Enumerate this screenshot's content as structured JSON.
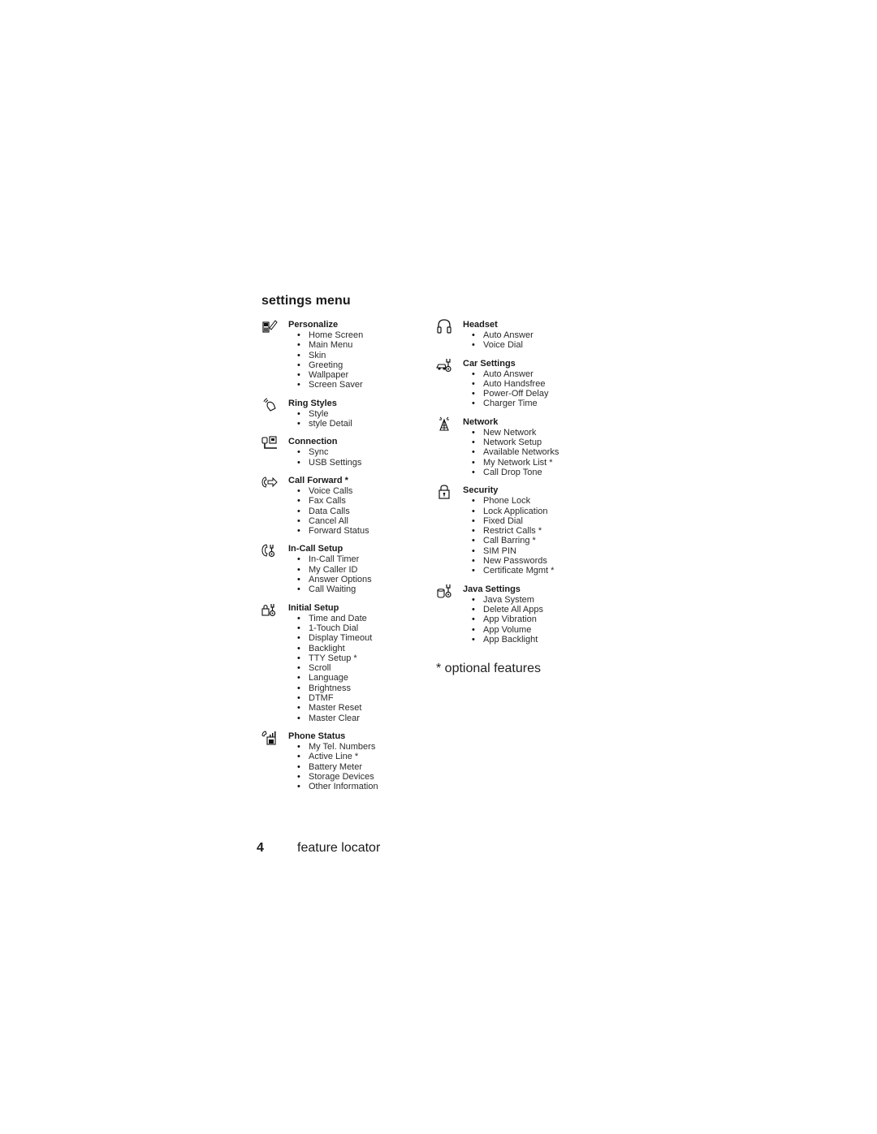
{
  "title": "settings menu",
  "left_column": [
    {
      "icon": "personalize-icon",
      "title": "Personalize",
      "items": [
        "Home Screen",
        "Main Menu",
        "Skin",
        "Greeting",
        "Wallpaper",
        "Screen Saver"
      ]
    },
    {
      "icon": "ring-styles-icon",
      "title": "Ring Styles",
      "items": [
        "Style",
        " style Detail"
      ]
    },
    {
      "icon": "connection-icon",
      "title": "Connection",
      "items": [
        "Sync",
        "USB Settings"
      ]
    },
    {
      "icon": "call-forward-icon",
      "title": "Call Forward *",
      "items": [
        "Voice Calls",
        "Fax Calls",
        "Data Calls",
        "Cancel All",
        "Forward Status"
      ]
    },
    {
      "icon": "in-call-setup-icon",
      "title": "In-Call Setup",
      "items": [
        "In-Call Timer",
        "My Caller ID",
        "Answer Options",
        "Call Waiting"
      ]
    },
    {
      "icon": "initial-setup-icon",
      "title": "Initial Setup",
      "items": [
        "Time and Date",
        "1-Touch Dial",
        "Display Timeout",
        "Backlight",
        "TTY Setup *",
        "Scroll",
        "Language",
        "Brightness",
        "DTMF",
        "Master Reset",
        "Master Clear"
      ]
    },
    {
      "icon": "phone-status-icon",
      "title": "Phone Status",
      "items": [
        "My Tel. Numbers",
        "Active Line *",
        "Battery Meter",
        "Storage Devices",
        "Other Information"
      ]
    }
  ],
  "right_column": [
    {
      "icon": "headset-icon",
      "title": "Headset",
      "items": [
        "Auto Answer",
        "Voice Dial"
      ]
    },
    {
      "icon": "car-settings-icon",
      "title": "Car Settings",
      "items": [
        "Auto Answer",
        "Auto Handsfree",
        "Power-Off Delay",
        "Charger Time"
      ]
    },
    {
      "icon": "network-icon",
      "title": "Network",
      "items": [
        "New Network",
        "Network Setup",
        "Available Networks",
        "My Network List *",
        "Call Drop Tone"
      ]
    },
    {
      "icon": "security-icon",
      "title": "Security",
      "items": [
        "Phone Lock",
        "Lock Application",
        "Fixed Dial",
        "Restrict Calls *",
        "Call Barring *",
        "SIM PIN",
        "New Passwords",
        "Certificate Mgmt *"
      ]
    },
    {
      "icon": "java-settings-icon",
      "title": "Java Settings",
      "items": [
        "Java System",
        "Delete All Apps",
        "App Vibration",
        "App Volume",
        "App Backlight"
      ]
    }
  ],
  "optional_note": "* optional features",
  "footer": {
    "page_number": "4",
    "label": "feature locator"
  }
}
